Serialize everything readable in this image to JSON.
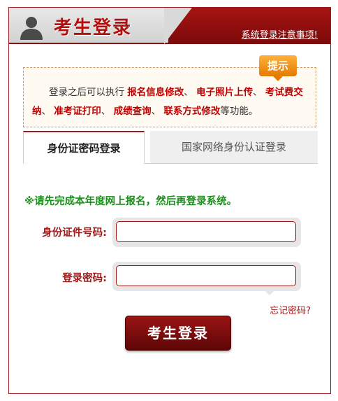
{
  "header": {
    "title": "考生登录",
    "notice_link": "系统登录注意事项!"
  },
  "tip": {
    "badge": "提示",
    "intro": "登录之后可以执行",
    "items": [
      "报名信息修改",
      "电子照片上传",
      "考试费交纳",
      "准考证打印",
      "成绩查询",
      "联系方式修改"
    ],
    "sep": "、",
    "suffix": "等功能。"
  },
  "tabs": [
    {
      "label": "身份证密码登录",
      "active": true
    },
    {
      "label": "国家网络身份认证登录",
      "active": false
    }
  ],
  "instruction": "※请先完成本年度网上报名，然后再登录系统。",
  "form": {
    "id_label": "身份证件号码:",
    "id_value": "",
    "password_label": "登录密码:",
    "password_value": "",
    "forgot_label": "忘记密码?",
    "submit_label": "考生登录"
  },
  "colors": {
    "brand_red": "#a11919",
    "instruction_green": "#1a8f1a",
    "tip_orange": "#e47a00"
  }
}
